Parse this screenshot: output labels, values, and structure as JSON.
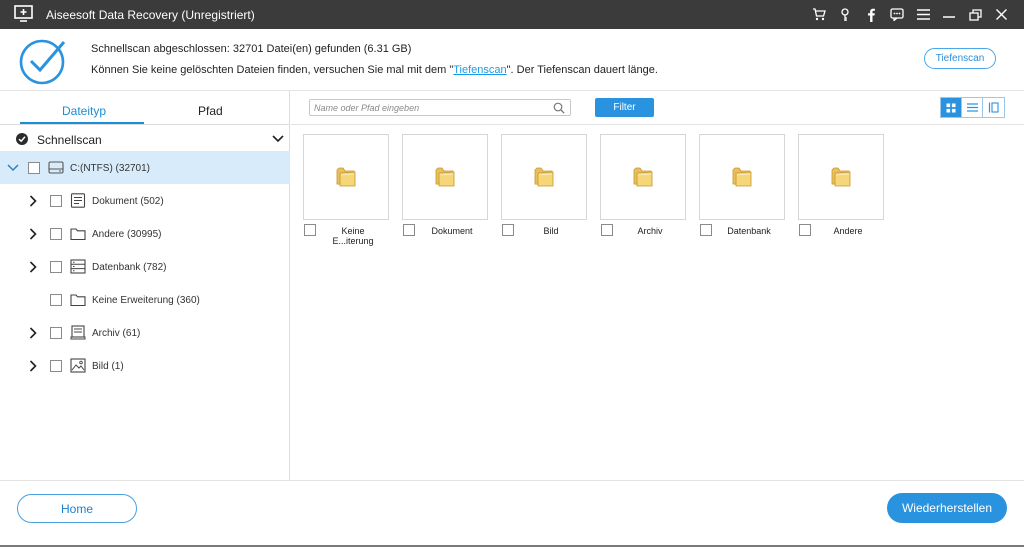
{
  "window": {
    "title": "Aiseesoft Data Recovery (Unregistriert)",
    "controls": [
      "cart-icon",
      "key-icon",
      "facebook-icon",
      "chat-icon",
      "menu-icon",
      "minimize-icon",
      "restore-icon",
      "close-icon"
    ]
  },
  "status": {
    "line1": "Schnellscan abgeschlossen: 32701 Datei(en) gefunden (6.31 GB)",
    "line2_prefix": "Können Sie keine gelöschten Dateien finden, versuchen Sie mal mit dem \"",
    "line2_link": "Tiefenscan",
    "line2_suffix": "\". Der Tiefenscan dauert länge.",
    "deep_scan_button": "Tiefenscan",
    "accent": "#1a9be6"
  },
  "sidebar": {
    "tabs": [
      {
        "label": "Dateityp",
        "active": true
      },
      {
        "label": "Pfad",
        "active": false
      }
    ],
    "scan_label": "Schnellscan",
    "drive": {
      "label": "C:(NTFS) (32701)",
      "icon": "hdd-icon",
      "expanded": true
    },
    "items": [
      {
        "label": "Dokument (502)",
        "icon": "document-icon",
        "expandable": true
      },
      {
        "label": "Andere (30995)",
        "icon": "folder-icon",
        "expandable": true
      },
      {
        "label": "Datenbank (782)",
        "icon": "database-icon",
        "expandable": true
      },
      {
        "label": "Keine Erweiterung (360)",
        "icon": "folder-icon",
        "expandable": false
      },
      {
        "label": "Archiv (61)",
        "icon": "archive-icon",
        "expandable": true
      },
      {
        "label": "Bild (1)",
        "icon": "image-icon",
        "expandable": true
      }
    ]
  },
  "toolbar": {
    "search_placeholder": "Name oder Pfad eingeben",
    "filter_label": "Filter",
    "views": [
      "grid-view-icon",
      "list-view-icon",
      "detail-view-icon"
    ],
    "active_view": "grid-view-icon"
  },
  "folders": [
    {
      "label": "Keine E...iterung"
    },
    {
      "label": "Dokument"
    },
    {
      "label": "Bild"
    },
    {
      "label": "Archiv"
    },
    {
      "label": "Datenbank"
    },
    {
      "label": "Andere"
    }
  ],
  "footer": {
    "home_label": "Home",
    "recover_label": "Wiederherstellen"
  }
}
